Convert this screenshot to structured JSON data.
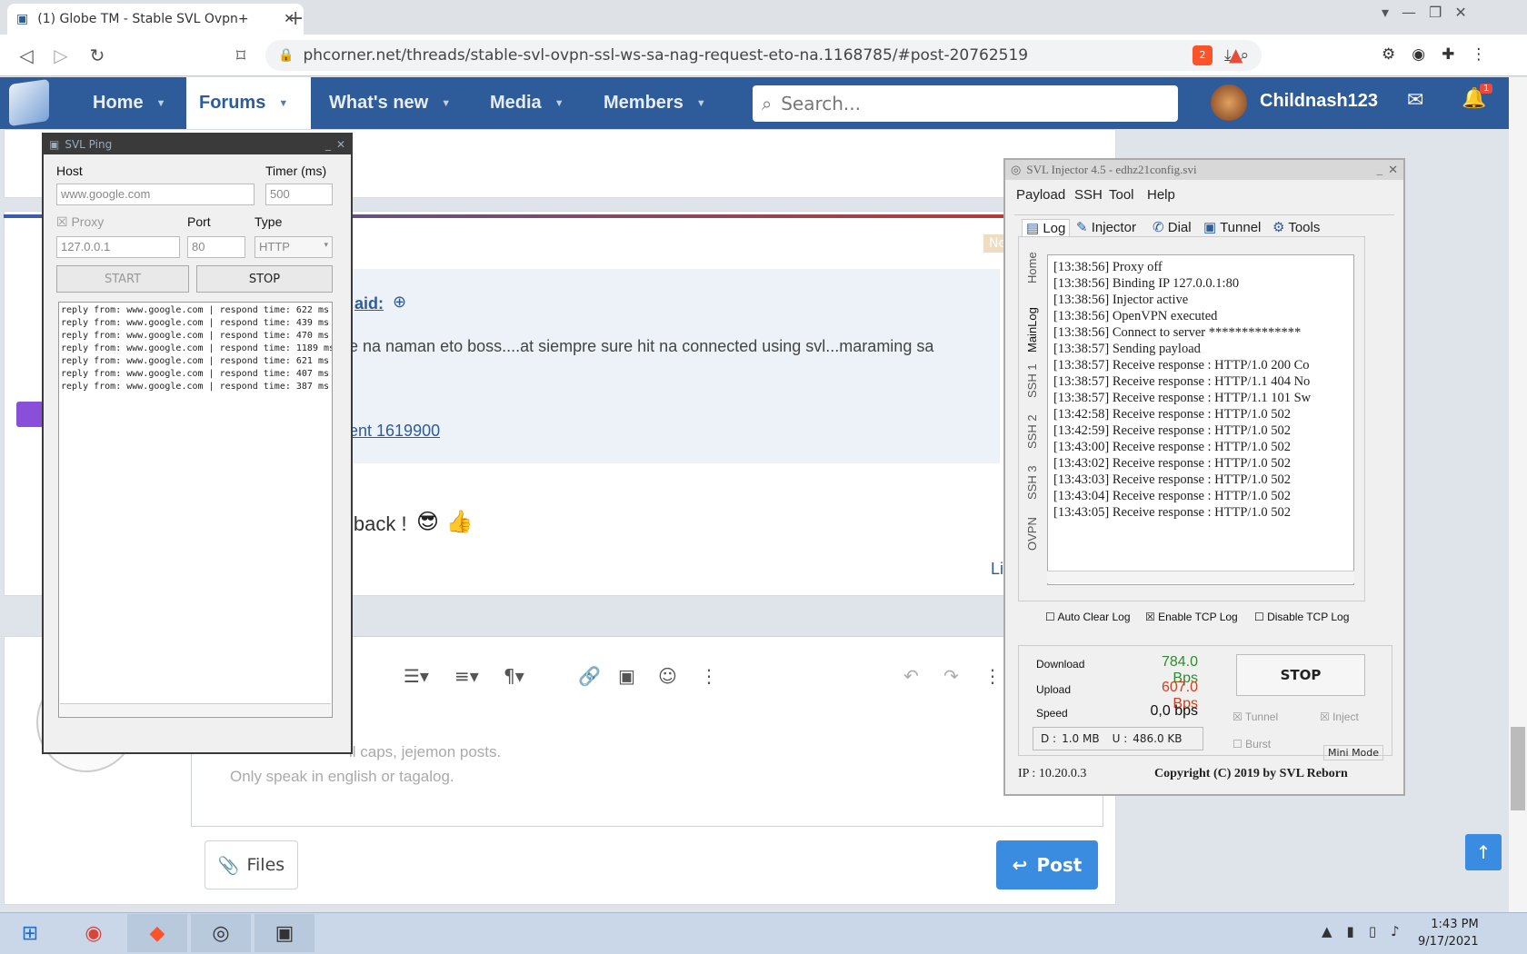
{
  "browser": {
    "tab_title": "(1) Globe TM - Stable SVL Ovpn+",
    "close": "✕",
    "new_tab": "+",
    "url": "phcorner.net/threads/stable-svl-ovpn-ssl-ws-sa-nag-request-eto-na.1168785/#post-20762519",
    "brave_badge": "2"
  },
  "forum_nav": {
    "items": [
      "Home",
      "Forums",
      "What's new",
      "Media",
      "Members"
    ],
    "search_placeholder": "Search...",
    "username": "Childnash123",
    "notif_count": "1"
  },
  "post": {
    "quote_author": "aid:",
    "quote_text": "e na naman eto boss....at siempre sure hit na connected using svl...maraming sa",
    "attachment": "ent 1619900",
    "reply": "lback !",
    "emojis": "😎 👍",
    "new_badge": "Ne",
    "likes": "Li"
  },
  "editor": {
    "line1": "ll caps, jejemon posts.",
    "line2": "Only speak in english or tagalog.",
    "files": "Files",
    "post": "Post"
  },
  "ping": {
    "title": "SVL Ping",
    "host_label": "Host",
    "host": "www.google.com",
    "timer_label": "Timer (ms)",
    "timer": "500",
    "proxy_label": "Proxy",
    "proxy": "127.0.0.1",
    "port_label": "Port",
    "port": "80",
    "type_label": "Type",
    "type": "HTTP",
    "start": "START",
    "stop": "STOP",
    "replies": [
      "reply from: www.google.com | respond time: 622 ms",
      "reply from: www.google.com | respond time: 439 ms",
      "reply from: www.google.com | respond time: 470 ms",
      "reply from: www.google.com | respond time: 1189 ms",
      "reply from: www.google.com | respond time: 621 ms",
      "reply from: www.google.com | respond time: 407 ms",
      "reply from: www.google.com | respond time: 387 ms"
    ]
  },
  "injector": {
    "title": "SVL Injector 4.5 - edhz21config.svi",
    "menu": [
      "Payload",
      "SSH",
      "Tool",
      "Help"
    ],
    "tabs": [
      "Log",
      "Injector",
      "Dial",
      "Tunnel",
      "Tools"
    ],
    "side_tabs": [
      "Home",
      "MainLog",
      "SSH 1",
      "SSH 2",
      "SSH 3",
      "OVPN"
    ],
    "log": [
      "[13:38:56] Proxy off",
      "[13:38:56] Binding IP 127.0.0.1:80",
      "[13:38:56] Injector active",
      "[13:38:56] OpenVPN executed",
      "[13:38:56] Connect to server **************",
      "[13:38:57] Sending payload",
      "[13:38:57] Receive response : HTTP/1.0 200 Co",
      "[13:38:57] Receive response : HTTP/1.1 404 No",
      "[13:38:57] Receive response : HTTP/1.1 101 Sw",
      "[13:42:58] Receive response : HTTP/1.0 502",
      "[13:42:59] Receive response : HTTP/1.0 502",
      "[13:43:00] Receive response : HTTP/1.0 502",
      "[13:43:02] Receive response : HTTP/1.0 502",
      "[13:43:03] Receive response : HTTP/1.0 502",
      "[13:43:04] Receive response : HTTP/1.0 502",
      "[13:43:05] Receive response : HTTP/1.0 502"
    ],
    "auto_clear": "Auto Clear Log",
    "enable_tcp": "Enable TCP Log",
    "disable_tcp": "Disable TCP Log",
    "download_label": "Download",
    "download": "784.0 Bps",
    "upload_label": "Upload",
    "upload": "607.0 Bps",
    "speed_label": "Speed",
    "speed": "0,0 bps",
    "d_label": "D :",
    "d_val": "1.0 MB",
    "u_label": "U :",
    "u_val": "486.0 KB",
    "stop": "STOP",
    "tunnel": "Tunnel",
    "inject": "Inject",
    "burst": "Burst",
    "mini_mode": "Mini Mode",
    "ip": "IP : 10.20.0.3",
    "copyright": "Copyright (C) 2019 by SVL Reborn"
  },
  "taskbar": {
    "time": "1:43 PM",
    "date": "9/17/2021"
  },
  "colors": {
    "nav": "#2e5b9a",
    "accent": "#3a8ce0",
    "download": "#2e8b2e",
    "upload": "#d04020"
  }
}
